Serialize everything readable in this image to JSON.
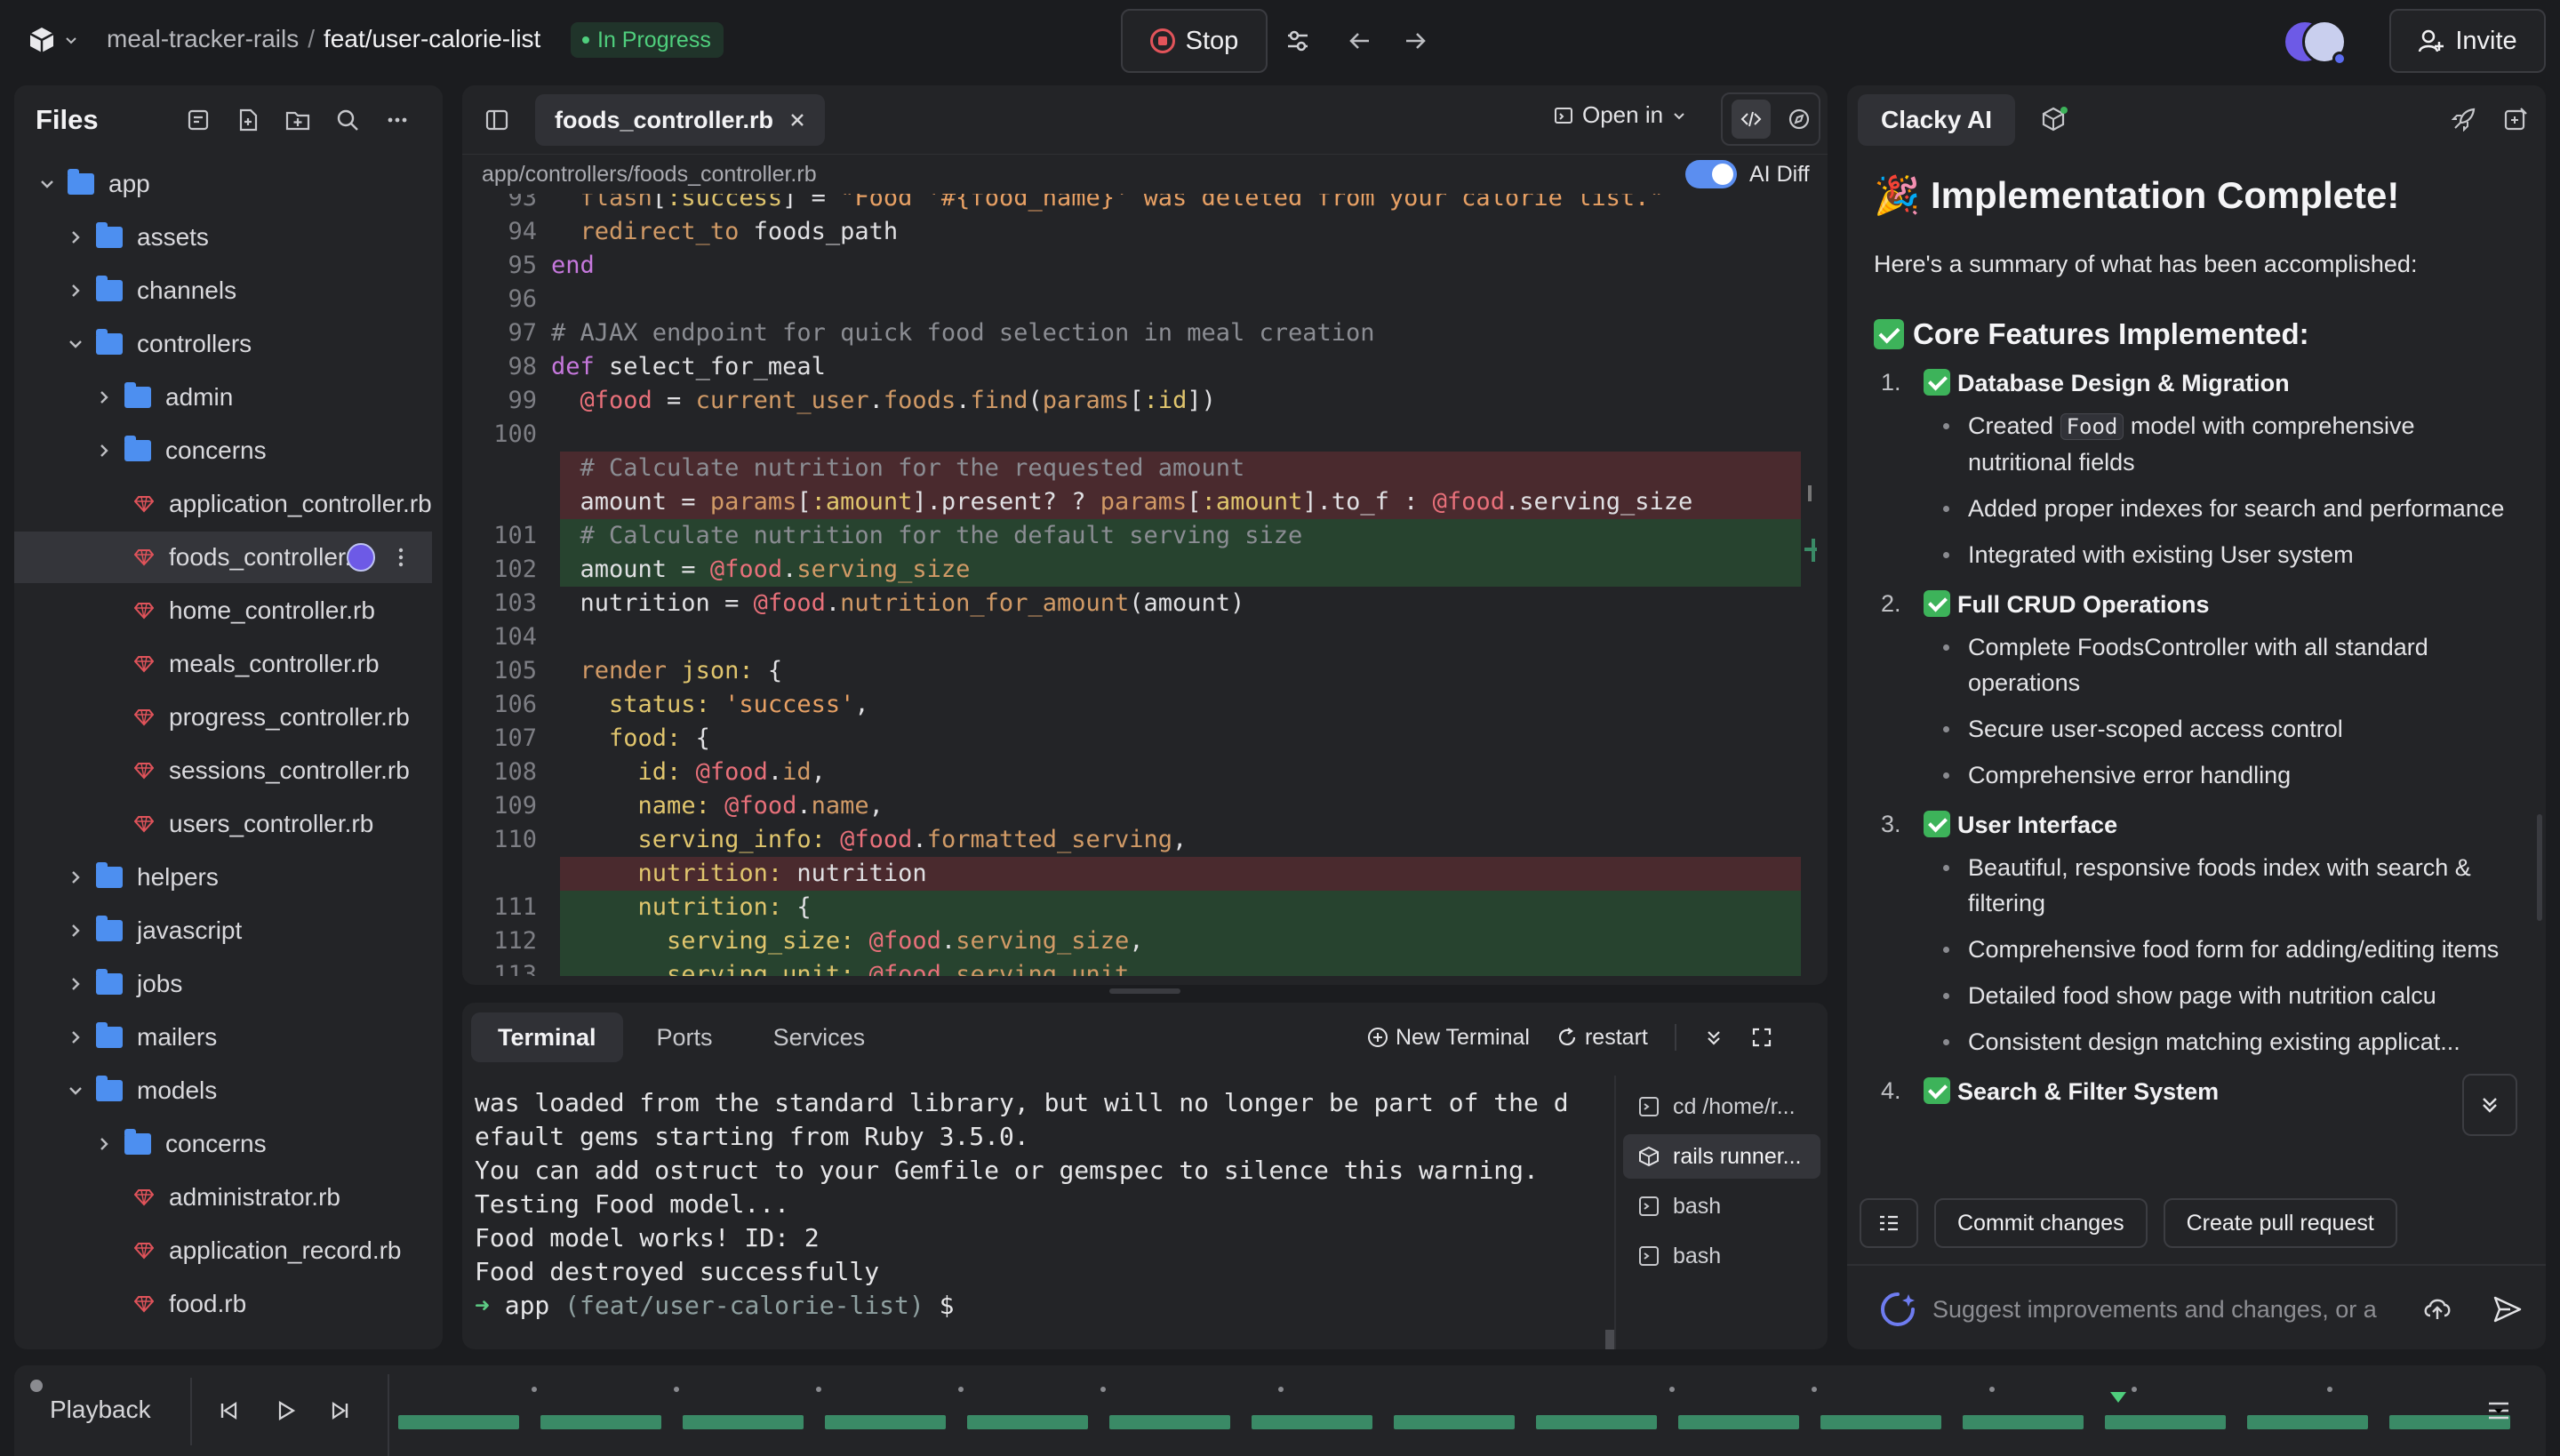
{
  "header": {
    "repo": "meal-tracker-rails",
    "separator": "/",
    "branch": "feat/user-calorie-list",
    "status": "In Progress",
    "stop_label": "Stop",
    "invite_label": "Invite",
    "status_color": "#4fcf7d"
  },
  "files": {
    "title": "Files",
    "tree": [
      {
        "label": "app",
        "type": "folder",
        "expanded": true,
        "depth": 0
      },
      {
        "label": "assets",
        "type": "folder",
        "expanded": false,
        "depth": 1
      },
      {
        "label": "channels",
        "type": "folder",
        "expanded": false,
        "depth": 1
      },
      {
        "label": "controllers",
        "type": "folder",
        "expanded": true,
        "depth": 1
      },
      {
        "label": "admin",
        "type": "folder",
        "expanded": false,
        "depth": 2
      },
      {
        "label": "concerns",
        "type": "folder",
        "expanded": false,
        "depth": 2
      },
      {
        "label": "application_controller.rb",
        "type": "ruby",
        "depth": 2
      },
      {
        "label": "foods_controller.rb",
        "type": "ruby",
        "depth": 2,
        "selected": true
      },
      {
        "label": "home_controller.rb",
        "type": "ruby",
        "depth": 2
      },
      {
        "label": "meals_controller.rb",
        "type": "ruby",
        "depth": 2
      },
      {
        "label": "progress_controller.rb",
        "type": "ruby",
        "depth": 2
      },
      {
        "label": "sessions_controller.rb",
        "type": "ruby",
        "depth": 2
      },
      {
        "label": "users_controller.rb",
        "type": "ruby",
        "depth": 2
      },
      {
        "label": "helpers",
        "type": "folder",
        "expanded": false,
        "depth": 1
      },
      {
        "label": "javascript",
        "type": "folder",
        "expanded": false,
        "depth": 1
      },
      {
        "label": "jobs",
        "type": "folder",
        "expanded": false,
        "depth": 1
      },
      {
        "label": "mailers",
        "type": "folder",
        "expanded": false,
        "depth": 1
      },
      {
        "label": "models",
        "type": "folder",
        "expanded": true,
        "depth": 1
      },
      {
        "label": "concerns",
        "type": "folder",
        "expanded": false,
        "depth": 2
      },
      {
        "label": "administrator.rb",
        "type": "ruby",
        "depth": 2
      },
      {
        "label": "application_record.rb",
        "type": "ruby",
        "depth": 2
      },
      {
        "label": "food.rb",
        "type": "ruby",
        "depth": 2
      }
    ]
  },
  "editor": {
    "tab_label": "foods_controller.rb",
    "open_in_label": "Open in",
    "path": "app/controllers/foods_controller.rb",
    "ai_diff_label": "AI Diff",
    "lines": [
      {
        "n": "93",
        "kind": "ctx",
        "html": "  <span class=\"mt\">flash</span>[<span class=\"sy\">:success</span>] = <span class=\"st\">\"Food '#{food_name}' was deleted from your calorie list.\"</span>"
      },
      {
        "n": "94",
        "kind": "ctx",
        "html": "  <span class=\"mt\">redirect_to</span> foods_path"
      },
      {
        "n": "95",
        "kind": "ctx",
        "html": "<span class=\"kw\">end</span>"
      },
      {
        "n": "96",
        "kind": "ctx",
        "html": ""
      },
      {
        "n": "97",
        "kind": "ctx",
        "html": "<span class=\"cm\"># AJAX endpoint for quick food selection in meal creation</span>"
      },
      {
        "n": "98",
        "kind": "ctx",
        "html": "<span class=\"kw\">def</span> select_for_meal"
      },
      {
        "n": "99",
        "kind": "ctx",
        "html": "  <span class=\"iv\">@food</span> = <span class=\"mt\">current_user</span>.<span class=\"mt\">foods</span>.<span class=\"mt\">find</span>(<span class=\"mt\">params</span>[<span class=\"sy\">:id</span>])"
      },
      {
        "n": "100",
        "kind": "ctx",
        "html": ""
      },
      {
        "n": "",
        "kind": "del",
        "html": "  <span class=\"cm\"># Calculate nutrition for the requested amount</span>"
      },
      {
        "n": "",
        "kind": "del",
        "html": "  amount = <span class=\"mt\">params</span>[<span class=\"sy\">:amount</span>].present? ? <span class=\"mt\">params</span>[<span class=\"sy\">:amount</span>].to_f : <span class=\"iv\">@food</span>.serving_size"
      },
      {
        "n": "101",
        "kind": "add",
        "html": "  <span class=\"cm\"># Calculate nutrition for the default serving size</span>"
      },
      {
        "n": "102",
        "kind": "add",
        "html": "  amount = <span class=\"iv\">@food</span>.<span class=\"mt\">serving_size</span>"
      },
      {
        "n": "103",
        "kind": "ctx",
        "html": "  nutrition = <span class=\"iv\">@food</span>.<span class=\"mt\">nutrition_for_amount</span>(amount)"
      },
      {
        "n": "104",
        "kind": "ctx",
        "html": ""
      },
      {
        "n": "105",
        "kind": "ctx",
        "html": "  <span class=\"mt\">render</span> <span class=\"sy\">json:</span> {"
      },
      {
        "n": "106",
        "kind": "ctx",
        "html": "    <span class=\"sy\">status:</span> <span class=\"st\">'success'</span>,"
      },
      {
        "n": "107",
        "kind": "ctx",
        "html": "    <span class=\"sy\">food:</span> {"
      },
      {
        "n": "108",
        "kind": "ctx",
        "html": "      <span class=\"sy\">id:</span> <span class=\"iv\">@food</span>.<span class=\"mt\">id</span>,"
      },
      {
        "n": "109",
        "kind": "ctx",
        "html": "      <span class=\"sy\">name:</span> <span class=\"iv\">@food</span>.<span class=\"mt\">name</span>,"
      },
      {
        "n": "110",
        "kind": "ctx",
        "html": "      <span class=\"sy\">serving_info:</span> <span class=\"iv\">@food</span>.<span class=\"mt\">formatted_serving</span>,"
      },
      {
        "n": "",
        "kind": "del",
        "html": "      <span class=\"sy\">nutrition:</span> nutrition"
      },
      {
        "n": "111",
        "kind": "add",
        "html": "      <span class=\"sy\">nutrition:</span> {"
      },
      {
        "n": "112",
        "kind": "add",
        "html": "        <span class=\"sy\">serving_size:</span> <span class=\"iv\">@food</span>.<span class=\"mt\">serving_size</span>,"
      },
      {
        "n": "113",
        "kind": "add",
        "html": "        <span class=\"sy\">serving_unit:</span> <span class=\"iv\">@food</span>.<span class=\"mt\">serving_unit</span>,"
      }
    ]
  },
  "terminal": {
    "tabs": [
      "Terminal",
      "Ports",
      "Services"
    ],
    "new_terminal_label": "New Terminal",
    "restart_label": "restart",
    "output": [
      "was loaded from the standard library, but will no longer be part of the d",
      "efault gems starting from Ruby 3.5.0.",
      "You can add ostruct to your Gemfile or gemspec to silence this warning.",
      "Testing Food model...",
      "Food model works! ID: 2",
      "Food destroyed successfully"
    ],
    "prompt_arrow": "➜",
    "prompt_dir": "app",
    "prompt_branch": "(feat/user-calorie-list)",
    "prompt_symbol": "$",
    "sessions": [
      "cd /home/r...",
      "rails runner...",
      "bash",
      "bash"
    ]
  },
  "ai": {
    "tab_label": "Clacky AI",
    "heading_emoji": "🎉",
    "heading": "Implementation Complete!",
    "intro": "Here's a summary of what has been accomplished:",
    "section_title": "Core Features Implemented:",
    "items": [
      {
        "num": "1.",
        "title": "Database Design & Migration",
        "bullets": [
          {
            "pre": "Created ",
            "code": "Food",
            "post": " model with comprehensive nutritional fields"
          },
          {
            "pre": "Added proper indexes for search and performance"
          },
          {
            "pre": "Integrated with existing User system"
          }
        ]
      },
      {
        "num": "2.",
        "title": "Full CRUD Operations",
        "bullets": [
          {
            "pre": "Complete FoodsController with all standard operations"
          },
          {
            "pre": "Secure user-scoped access control"
          },
          {
            "pre": "Comprehensive error handling"
          }
        ]
      },
      {
        "num": "3.",
        "title": "User Interface",
        "bullets": [
          {
            "pre": "Beautiful, responsive foods index with search & filtering"
          },
          {
            "pre": "Comprehensive food form for adding/editing items"
          },
          {
            "pre": "Detailed food show page with nutrition calcu"
          },
          {
            "pre": "Consistent design matching existing applicat..."
          }
        ]
      },
      {
        "num": "4.",
        "title": "Search & Filter System",
        "bullets": []
      }
    ],
    "commit_label": "Commit changes",
    "pr_label": "Create pull request",
    "input_placeholder": "Suggest improvements and changes, or a"
  },
  "playback": {
    "label": "Playback"
  }
}
